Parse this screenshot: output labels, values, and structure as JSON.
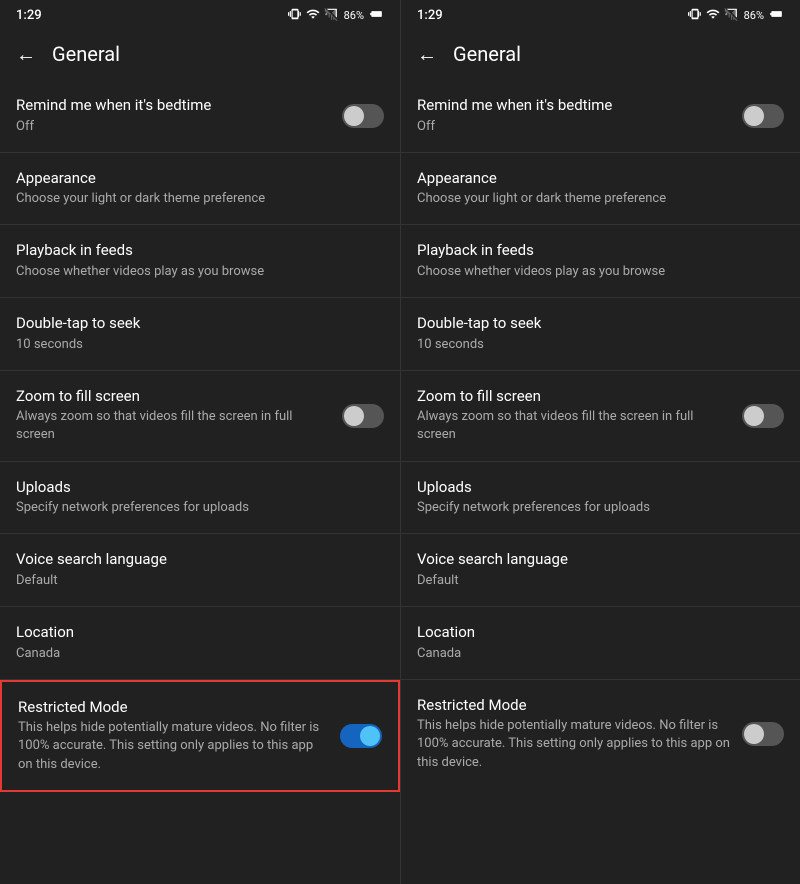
{
  "screens": [
    {
      "id": "screen-left",
      "statusBar": {
        "time": "1:29",
        "battery": "86%"
      },
      "header": {
        "backLabel": "←",
        "title": "General"
      },
      "settings": [
        {
          "id": "bedtime",
          "title": "Remind me when it's bedtime",
          "subtitle": "Off",
          "hasToggle": true,
          "toggleOn": false
        },
        {
          "id": "appearance",
          "title": "Appearance",
          "subtitle": "Choose your light or dark theme preference",
          "hasToggle": false,
          "toggleOn": false
        },
        {
          "id": "playback-feeds",
          "title": "Playback in feeds",
          "subtitle": "Choose whether videos play as you browse",
          "hasToggle": false,
          "toggleOn": false
        },
        {
          "id": "double-tap",
          "title": "Double-tap to seek",
          "subtitle": "10 seconds",
          "hasToggle": false,
          "toggleOn": false
        },
        {
          "id": "zoom-fill",
          "title": "Zoom to fill screen",
          "subtitle": "Always zoom so that videos fill the screen in full screen",
          "hasToggle": true,
          "toggleOn": false
        },
        {
          "id": "uploads",
          "title": "Uploads",
          "subtitle": "Specify network preferences for uploads",
          "hasToggle": false,
          "toggleOn": false
        },
        {
          "id": "voice-search",
          "title": "Voice search language",
          "subtitle": "Default",
          "hasToggle": false,
          "toggleOn": false
        },
        {
          "id": "location",
          "title": "Location",
          "subtitle": "Canada",
          "hasToggle": false,
          "toggleOn": false
        },
        {
          "id": "restricted-mode",
          "title": "Restricted Mode",
          "subtitle": "This helps hide potentially mature videos. No filter is 100% accurate. This setting only applies to this app on this device.",
          "hasToggle": true,
          "toggleOn": true,
          "highlighted": true
        }
      ]
    },
    {
      "id": "screen-right",
      "statusBar": {
        "time": "1:29",
        "battery": "86%"
      },
      "header": {
        "backLabel": "←",
        "title": "General"
      },
      "settings": [
        {
          "id": "bedtime",
          "title": "Remind me when it's bedtime",
          "subtitle": "Off",
          "hasToggle": true,
          "toggleOn": false
        },
        {
          "id": "appearance",
          "title": "Appearance",
          "subtitle": "Choose your light or dark theme preference",
          "hasToggle": false,
          "toggleOn": false
        },
        {
          "id": "playback-feeds",
          "title": "Playback in feeds",
          "subtitle": "Choose whether videos play as you browse",
          "hasToggle": false,
          "toggleOn": false
        },
        {
          "id": "double-tap",
          "title": "Double-tap to seek",
          "subtitle": "10 seconds",
          "hasToggle": false,
          "toggleOn": false
        },
        {
          "id": "zoom-fill",
          "title": "Zoom to fill screen",
          "subtitle": "Always zoom so that videos fill the screen in full screen",
          "hasToggle": true,
          "toggleOn": false
        },
        {
          "id": "uploads",
          "title": "Uploads",
          "subtitle": "Specify network preferences for uploads",
          "hasToggle": false,
          "toggleOn": false
        },
        {
          "id": "voice-search",
          "title": "Voice search language",
          "subtitle": "Default",
          "hasToggle": false,
          "toggleOn": false
        },
        {
          "id": "location",
          "title": "Location",
          "subtitle": "Canada",
          "hasToggle": false,
          "toggleOn": false
        },
        {
          "id": "restricted-mode",
          "title": "Restricted Mode",
          "subtitle": "This helps hide potentially mature videos. No filter is 100% accurate. This setting only applies to this app on this device.",
          "hasToggle": true,
          "toggleOn": false,
          "highlighted": false
        }
      ]
    }
  ]
}
